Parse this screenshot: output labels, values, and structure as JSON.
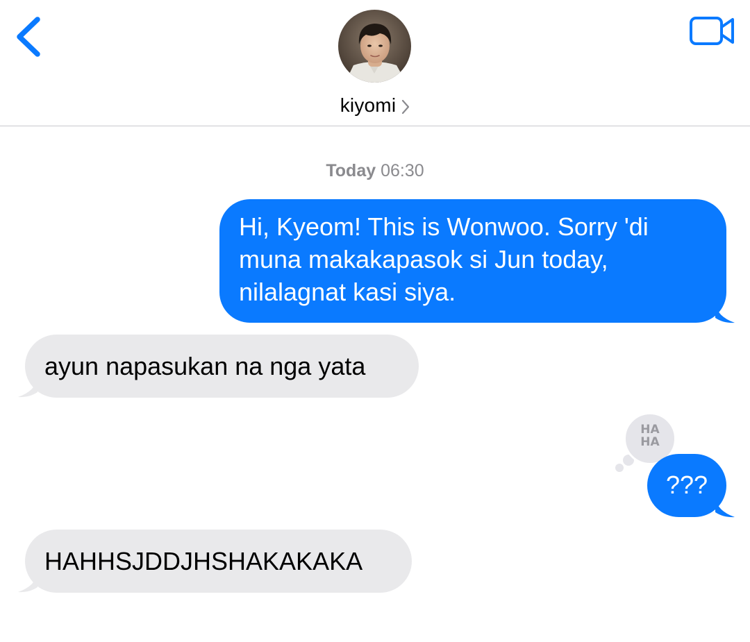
{
  "header": {
    "contact_name": "kiyomi",
    "back_icon": "chevron-left-icon",
    "video_icon": "video-camera-icon",
    "chevron_icon": "chevron-right-icon",
    "accent_color": "#0A7AFF"
  },
  "conversation": {
    "timestamp": {
      "day": "Today",
      "time": "06:30"
    },
    "messages": [
      {
        "direction": "sent",
        "text": "Hi, Kyeom! This is Wonwoo. Sorry 'di muna makakapasok si Jun today, nilalagnat kasi siya."
      },
      {
        "direction": "received",
        "text": "ayun napasukan na nga yata"
      },
      {
        "direction": "sent",
        "text": "???",
        "tapback": {
          "type": "haha",
          "label_line1": "HA",
          "label_line2": "HA"
        }
      },
      {
        "direction": "received",
        "text": "HAHHSJDDJHSHAKAKAKA"
      }
    ]
  },
  "colors": {
    "sent_bubble": "#0A7AFF",
    "received_bubble": "#E9E9EB",
    "timestamp_text": "#8A8A8E"
  }
}
